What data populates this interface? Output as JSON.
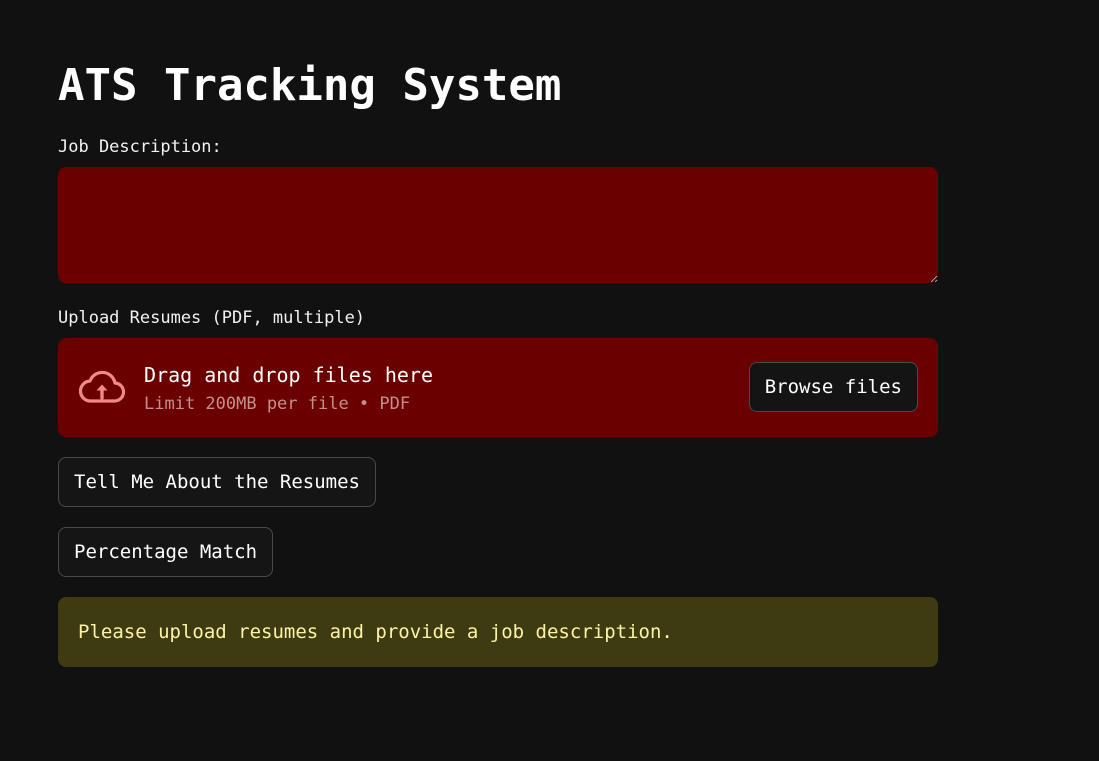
{
  "page": {
    "title": "ATS Tracking System"
  },
  "job_description": {
    "label": "Job Description:",
    "value": "",
    "placeholder": ""
  },
  "upload": {
    "label": "Upload Resumes (PDF, multiple)",
    "drop_title": "Drag and drop files here",
    "drop_subtitle": "Limit 200MB per file • PDF",
    "icon": "cloud-upload-icon",
    "browse_label": "Browse files"
  },
  "actions": {
    "tell_label": "Tell Me About the Resumes",
    "percentage_label": "Percentage Match"
  },
  "alert": {
    "message": "Please upload resumes and provide a job description."
  },
  "colors": {
    "background": "#111111",
    "input_background": "#6a0000",
    "alert_background": "#3e3b12",
    "alert_text": "#fdf3a6",
    "upload_icon": "#f08a8a"
  }
}
